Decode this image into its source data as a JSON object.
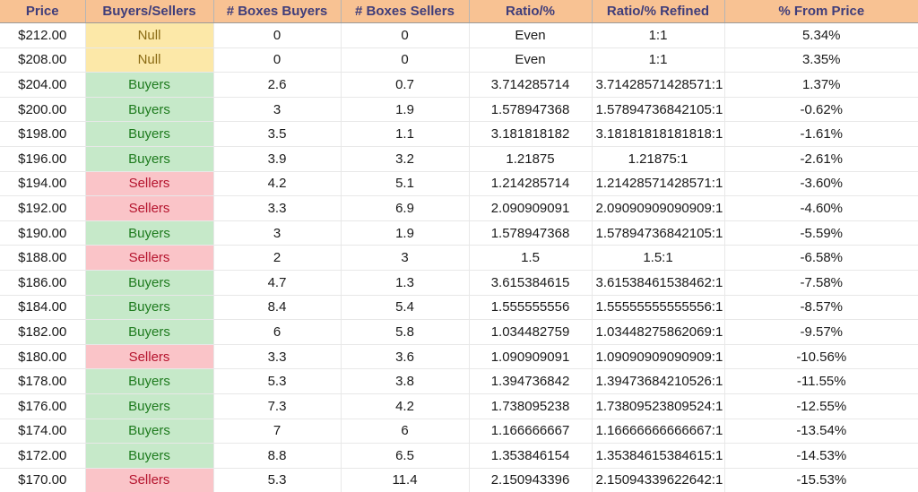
{
  "table": {
    "columns": [
      {
        "key": "price",
        "label": "Price"
      },
      {
        "key": "side",
        "label": "Buyers/Sellers"
      },
      {
        "key": "boxes_buyers",
        "label": "# Boxes Buyers"
      },
      {
        "key": "boxes_sellers",
        "label": "# Boxes Sellers"
      },
      {
        "key": "ratio",
        "label": "Ratio/%"
      },
      {
        "key": "ratio_refined",
        "label": "Ratio/% Refined"
      },
      {
        "key": "pct_from_price",
        "label": "% From Price"
      }
    ],
    "colors": {
      "header_bg": "#f8c293",
      "header_text": "#3f3d7a",
      "null_bg": "#fce8a8",
      "null_text": "#8a6a13",
      "buyers_bg": "#c6e9c9",
      "buyers_text": "#1e7b1e",
      "sellers_bg": "#fac4c8",
      "sellers_text": "#b5142e",
      "gridline": "#e8e8e8",
      "cell_text": "#1a1a1a"
    },
    "rows": [
      {
        "price": "$212.00",
        "side": "Null",
        "side_state": "null",
        "boxes_buyers": "0",
        "boxes_sellers": "0",
        "ratio": "Even",
        "ratio_refined": "1:1",
        "pct_from_price": "5.34%"
      },
      {
        "price": "$208.00",
        "side": "Null",
        "side_state": "null",
        "boxes_buyers": "0",
        "boxes_sellers": "0",
        "ratio": "Even",
        "ratio_refined": "1:1",
        "pct_from_price": "3.35%"
      },
      {
        "price": "$204.00",
        "side": "Buyers",
        "side_state": "buyers",
        "boxes_buyers": "2.6",
        "boxes_sellers": "0.7",
        "ratio": "3.714285714",
        "ratio_refined": "3.71428571428571:1",
        "pct_from_price": "1.37%"
      },
      {
        "price": "$200.00",
        "side": "Buyers",
        "side_state": "buyers",
        "boxes_buyers": "3",
        "boxes_sellers": "1.9",
        "ratio": "1.578947368",
        "ratio_refined": "1.57894736842105:1",
        "pct_from_price": "-0.62%"
      },
      {
        "price": "$198.00",
        "side": "Buyers",
        "side_state": "buyers",
        "boxes_buyers": "3.5",
        "boxes_sellers": "1.1",
        "ratio": "3.181818182",
        "ratio_refined": "3.18181818181818:1",
        "pct_from_price": "-1.61%"
      },
      {
        "price": "$196.00",
        "side": "Buyers",
        "side_state": "buyers",
        "boxes_buyers": "3.9",
        "boxes_sellers": "3.2",
        "ratio": "1.21875",
        "ratio_refined": "1.21875:1",
        "pct_from_price": "-2.61%"
      },
      {
        "price": "$194.00",
        "side": "Sellers",
        "side_state": "sellers",
        "boxes_buyers": "4.2",
        "boxes_sellers": "5.1",
        "ratio": "1.214285714",
        "ratio_refined": "1.21428571428571:1",
        "pct_from_price": "-3.60%"
      },
      {
        "price": "$192.00",
        "side": "Sellers",
        "side_state": "sellers",
        "boxes_buyers": "3.3",
        "boxes_sellers": "6.9",
        "ratio": "2.090909091",
        "ratio_refined": "2.09090909090909:1",
        "pct_from_price": "-4.60%"
      },
      {
        "price": "$190.00",
        "side": "Buyers",
        "side_state": "buyers",
        "boxes_buyers": "3",
        "boxes_sellers": "1.9",
        "ratio": "1.578947368",
        "ratio_refined": "1.57894736842105:1",
        "pct_from_price": "-5.59%"
      },
      {
        "price": "$188.00",
        "side": "Sellers",
        "side_state": "sellers",
        "boxes_buyers": "2",
        "boxes_sellers": "3",
        "ratio": "1.5",
        "ratio_refined": "1.5:1",
        "pct_from_price": "-6.58%"
      },
      {
        "price": "$186.00",
        "side": "Buyers",
        "side_state": "buyers",
        "boxes_buyers": "4.7",
        "boxes_sellers": "1.3",
        "ratio": "3.615384615",
        "ratio_refined": "3.61538461538462:1",
        "pct_from_price": "-7.58%"
      },
      {
        "price": "$184.00",
        "side": "Buyers",
        "side_state": "buyers",
        "boxes_buyers": "8.4",
        "boxes_sellers": "5.4",
        "ratio": "1.555555556",
        "ratio_refined": "1.55555555555556:1",
        "pct_from_price": "-8.57%"
      },
      {
        "price": "$182.00",
        "side": "Buyers",
        "side_state": "buyers",
        "boxes_buyers": "6",
        "boxes_sellers": "5.8",
        "ratio": "1.034482759",
        "ratio_refined": "1.03448275862069:1",
        "pct_from_price": "-9.57%"
      },
      {
        "price": "$180.00",
        "side": "Sellers",
        "side_state": "sellers",
        "boxes_buyers": "3.3",
        "boxes_sellers": "3.6",
        "ratio": "1.090909091",
        "ratio_refined": "1.09090909090909:1",
        "pct_from_price": "-10.56%"
      },
      {
        "price": "$178.00",
        "side": "Buyers",
        "side_state": "buyers",
        "boxes_buyers": "5.3",
        "boxes_sellers": "3.8",
        "ratio": "1.394736842",
        "ratio_refined": "1.39473684210526:1",
        "pct_from_price": "-11.55%"
      },
      {
        "price": "$176.00",
        "side": "Buyers",
        "side_state": "buyers",
        "boxes_buyers": "7.3",
        "boxes_sellers": "4.2",
        "ratio": "1.738095238",
        "ratio_refined": "1.73809523809524:1",
        "pct_from_price": "-12.55%"
      },
      {
        "price": "$174.00",
        "side": "Buyers",
        "side_state": "buyers",
        "boxes_buyers": "7",
        "boxes_sellers": "6",
        "ratio": "1.166666667",
        "ratio_refined": "1.16666666666667:1",
        "pct_from_price": "-13.54%"
      },
      {
        "price": "$172.00",
        "side": "Buyers",
        "side_state": "buyers",
        "boxes_buyers": "8.8",
        "boxes_sellers": "6.5",
        "ratio": "1.353846154",
        "ratio_refined": "1.35384615384615:1",
        "pct_from_price": "-14.53%"
      },
      {
        "price": "$170.00",
        "side": "Sellers",
        "side_state": "sellers",
        "boxes_buyers": "5.3",
        "boxes_sellers": "11.4",
        "ratio": "2.150943396",
        "ratio_refined": "2.15094339622642:1",
        "pct_from_price": "-15.53%"
      }
    ]
  }
}
